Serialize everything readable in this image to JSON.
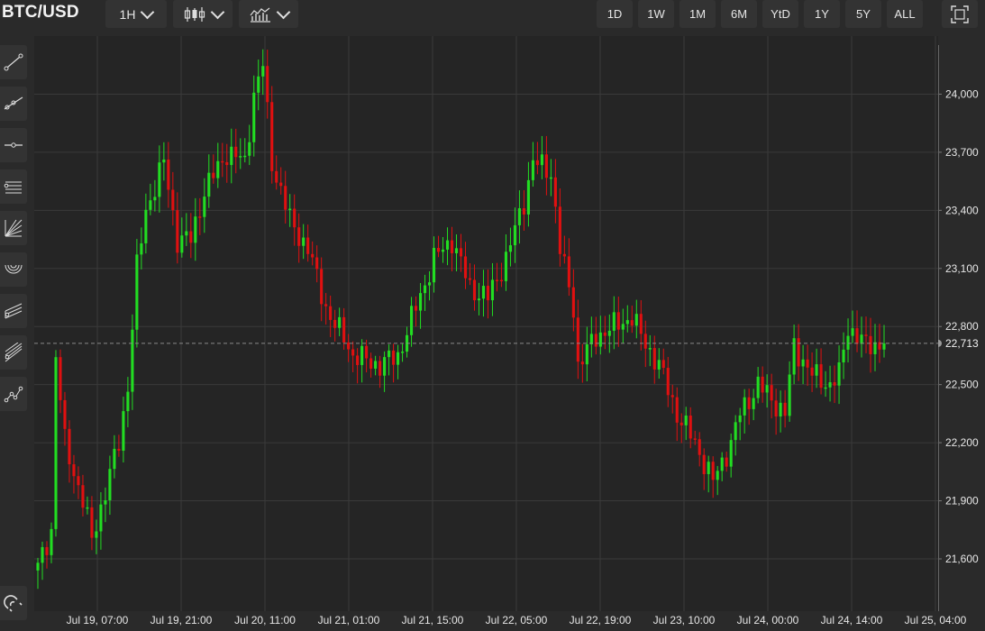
{
  "header": {
    "symbol": "BTC/USD",
    "interval_label": "1H",
    "chart_style_icon": "candlestick-icon",
    "indicators_icon": "indicators-chart-icon",
    "ranges": [
      "1D",
      "1W",
      "1M",
      "6M",
      "YtD",
      "1Y",
      "5Y",
      "ALL"
    ],
    "fullscreen_icon": "fullscreen-icon"
  },
  "sidebar": {
    "tools": [
      "trend-line-icon",
      "ray-icon",
      "horizontal-line-icon",
      "parallel-channel-icon",
      "fan-icon",
      "arc-icon",
      "pitchfork-icon",
      "fib-channel-icon",
      "path-icon"
    ],
    "bottom_tool": "magnet-icon"
  },
  "chart_data": {
    "type": "candlestick",
    "y_axis": {
      "ticks": [
        21600,
        21900,
        22200,
        22500,
        22800,
        23100,
        23400,
        23700,
        24000
      ],
      "tick_labels": [
        "21,600",
        "21,900",
        "22,200",
        "22,500",
        "22,800",
        "23,100",
        "23,400",
        "23,700",
        "24,000"
      ],
      "range": [
        21330,
        24300
      ],
      "side": "right"
    },
    "x_axis": {
      "tick_labels": [
        "Jul 19, 07:00",
        "Jul 19, 21:00",
        "Jul 20, 11:00",
        "Jul 21, 01:00",
        "Jul 21, 15:00",
        "Jul 22, 05:00",
        "Jul 22, 19:00",
        "Jul 23, 10:00",
        "Jul 24, 00:00",
        "Jul 24, 14:00",
        "Jul 25, 04:00"
      ]
    },
    "last_price": 22713,
    "last_price_label": "22,713",
    "up_color": "#22dd22",
    "down_color": "#e01010",
    "grid": true,
    "grid_color": "#3a3a3a",
    "keypoints": [
      [
        0,
        21550
      ],
      [
        3,
        21750
      ],
      [
        4,
        22650
      ],
      [
        6,
        22200
      ],
      [
        10,
        21900
      ],
      [
        12,
        21700
      ],
      [
        15,
        21950
      ],
      [
        18,
        22200
      ],
      [
        20,
        22500
      ],
      [
        22,
        23100
      ],
      [
        24,
        23400
      ],
      [
        28,
        23650
      ],
      [
        31,
        23250
      ],
      [
        34,
        23250
      ],
      [
        37,
        23500
      ],
      [
        42,
        23700
      ],
      [
        46,
        23650
      ],
      [
        48,
        24000
      ],
      [
        50,
        24150
      ],
      [
        52,
        23650
      ],
      [
        56,
        23350
      ],
      [
        60,
        23200
      ],
      [
        64,
        22900
      ],
      [
        66,
        22800
      ],
      [
        68,
        22750
      ],
      [
        70,
        22650
      ],
      [
        76,
        22600
      ],
      [
        80,
        22650
      ],
      [
        84,
        22900
      ],
      [
        88,
        23150
      ],
      [
        92,
        23250
      ],
      [
        96,
        23000
      ],
      [
        100,
        22950
      ],
      [
        104,
        23150
      ],
      [
        108,
        23450
      ],
      [
        110,
        23650
      ],
      [
        114,
        23600
      ],
      [
        116,
        23200
      ],
      [
        119,
        22900
      ],
      [
        120,
        22600
      ],
      [
        124,
        22750
      ],
      [
        128,
        22800
      ],
      [
        132,
        22850
      ],
      [
        134,
        22750
      ],
      [
        138,
        22600
      ],
      [
        142,
        22350
      ],
      [
        146,
        22200
      ],
      [
        150,
        22000
      ],
      [
        154,
        22200
      ],
      [
        156,
        22350
      ],
      [
        160,
        22500
      ],
      [
        166,
        22350
      ],
      [
        168,
        22700
      ],
      [
        172,
        22550
      ],
      [
        176,
        22500
      ],
      [
        178,
        22550
      ],
      [
        180,
        22800
      ],
      [
        182,
        22750
      ],
      [
        184,
        22700
      ],
      [
        186,
        22710
      ],
      [
        188,
        22713
      ]
    ]
  }
}
